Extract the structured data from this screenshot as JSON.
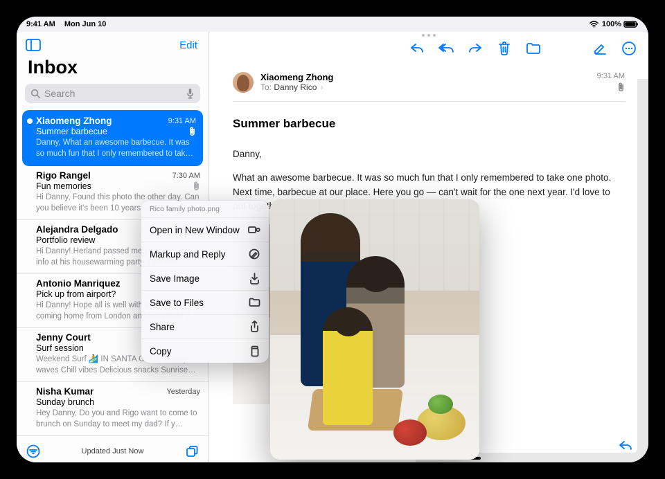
{
  "status_bar": {
    "time": "9:41 AM",
    "date": "Mon Jun 10",
    "wifi_icon": "wifi-icon",
    "battery_pct": "100%",
    "battery_icon": "battery-icon"
  },
  "sidebar": {
    "edit_label": "Edit",
    "title": "Inbox",
    "search_placeholder": "Search",
    "footer_status": "Updated Just Now",
    "items": [
      {
        "sender": "Xiaomeng Zhong",
        "time": "9:31 AM",
        "subject": "Summer barbecue",
        "preview": "Danny, What an awesome barbecue. It was so much fun that I only remembered to tak…",
        "unread": true,
        "has_attachment": true,
        "selected": true
      },
      {
        "sender": "Rigo Rangel",
        "time": "7:30 AM",
        "subject": "Fun memories",
        "preview": "Hi Danny, Found this photo the other day. Can you believe it's been 10 years since…",
        "unread": false,
        "has_attachment": true,
        "selected": false
      },
      {
        "sender": "Alejandra Delgado",
        "time": "",
        "subject": "Portfolio review",
        "preview": "Hi Danny! Herland passed me your contact info at his housewarming party. I wanted…",
        "unread": false,
        "has_attachment": false,
        "selected": false
      },
      {
        "sender": "Antonio Manriquez",
        "time": "",
        "subject": "Pick up from airport?",
        "preview": "Hi Danny! Hope all is well with you! I'm coming home from London and wondered if…",
        "unread": false,
        "has_attachment": false,
        "selected": false
      },
      {
        "sender": "Jenny Court",
        "time": "",
        "subject": "Surf session",
        "preview": "Weekend Surf 🏄 IN SANTA CRUZ Glassy waves Chill vibes Delicious snacks Sunrise…",
        "unread": false,
        "has_attachment": false,
        "selected": false
      },
      {
        "sender": "Nisha Kumar",
        "time": "Yesterday",
        "subject": "Sunday brunch",
        "preview": "Hey Danny, Do you and Rigo want to come to brunch on Sunday to meet my dad? If y…",
        "unread": false,
        "has_attachment": false,
        "selected": false
      }
    ]
  },
  "detail": {
    "toolbar": {
      "reply": "reply-icon",
      "reply_all": "reply-all-icon",
      "forward": "forward-icon",
      "trash": "trash-icon",
      "move": "move-icon",
      "compose": "compose-icon",
      "more": "more-icon"
    },
    "header": {
      "from": "Xiaomeng Zhong",
      "to_label": "To:",
      "to_name": "Danny Rico",
      "time": "9:31 AM",
      "has_attachment": true
    },
    "subject": "Summer barbecue",
    "body": {
      "salutation": "Danny,",
      "p1": "What an awesome barbecue. It was so much fun that I only remembered to take one photo. Next time, barbecue at our place. Here you go — can't wait for the one next year. I'd love to put together an album."
    },
    "attachment_alt": "Rico family photo attachment"
  },
  "context_menu": {
    "file_name": "Rico family photo.png",
    "items": [
      {
        "label": "Open in New Window",
        "icon": "new-window-icon"
      },
      {
        "label": "Markup and Reply",
        "icon": "markup-icon"
      },
      {
        "label": "Save Image",
        "icon": "download-icon"
      },
      {
        "label": "Save to Files",
        "icon": "folder-icon"
      },
      {
        "label": "Share",
        "icon": "share-icon"
      },
      {
        "label": "Copy",
        "icon": "copy-icon"
      }
    ]
  },
  "colors": {
    "accent": "#007aff"
  }
}
